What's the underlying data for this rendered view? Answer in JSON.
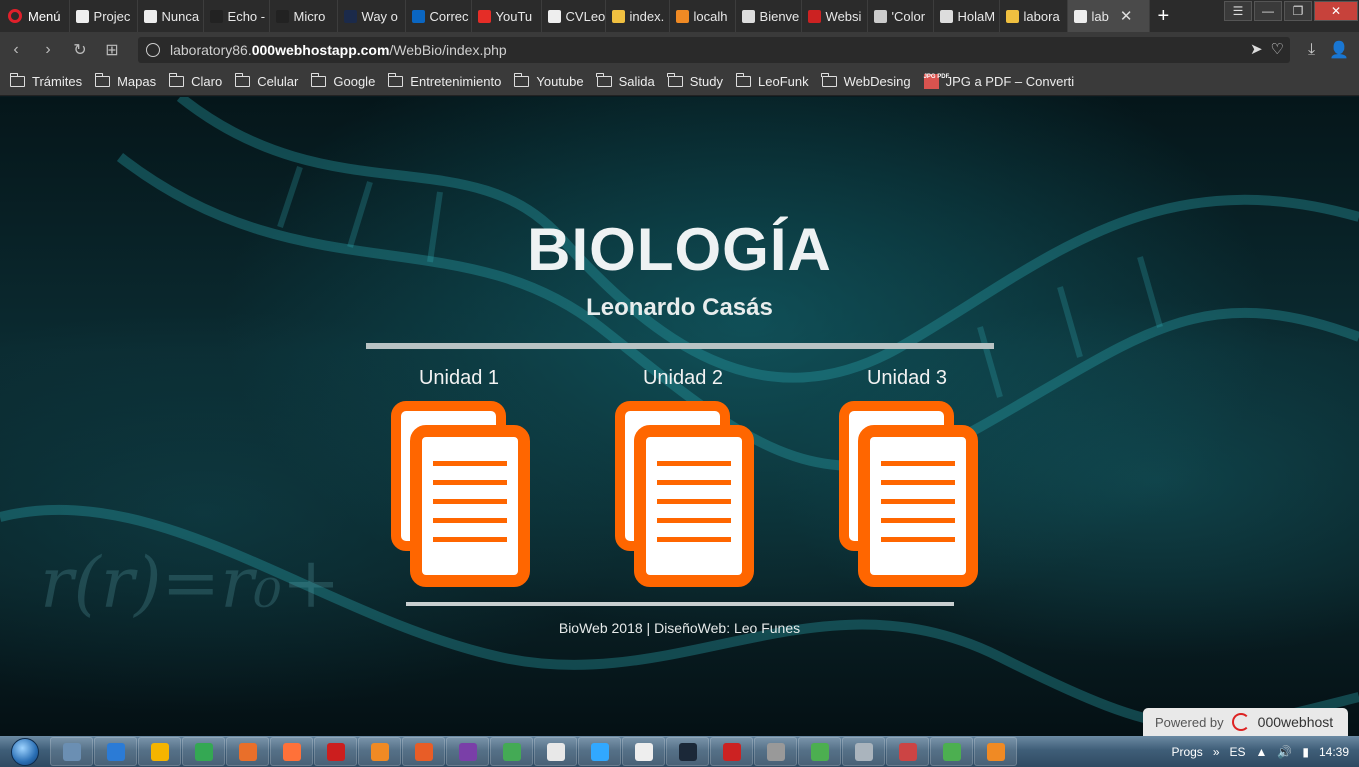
{
  "browser": {
    "menu_label": "Menú",
    "tabs": [
      {
        "label": "Projec",
        "color": "#eeeeee"
      },
      {
        "label": "Nunca",
        "color": "#eeeeee"
      },
      {
        "label": "Echo -",
        "color": "#222222"
      },
      {
        "label": "Micro",
        "color": "#222222"
      },
      {
        "label": "Way o",
        "color": "#1b2a4a"
      },
      {
        "label": "Correc",
        "color": "#0a66c2"
      },
      {
        "label": "YouTu",
        "color": "#e52d27"
      },
      {
        "label": "CVLeo",
        "color": "#eeeeee"
      },
      {
        "label": "index.",
        "color": "#f0c040"
      },
      {
        "label": "localh",
        "color": "#f08a24"
      },
      {
        "label": "Bienve",
        "color": "#dddddd"
      },
      {
        "label": "Websi",
        "color": "#cc2222"
      },
      {
        "label": "'Color",
        "color": "#cccccc"
      },
      {
        "label": "HolaM",
        "color": "#dddddd"
      },
      {
        "label": "labora",
        "color": "#f0c040"
      },
      {
        "label": "lab",
        "color": "#eeeeee"
      }
    ],
    "url_prefix": "laboratory86.",
    "url_domain": "000webhostapp.com",
    "url_path": "/WebBio/index.php",
    "bookmarks": [
      "Trámites",
      "Mapas",
      "Claro",
      "Celular",
      "Google",
      "Entretenimiento",
      "Youtube",
      "Salida",
      "Study",
      "LeoFunk",
      "WebDesing"
    ],
    "bookmark_pdf": "JPG a PDF – Converti",
    "bookmark_pdf_icon": "JPG PDF"
  },
  "page": {
    "title": "BIOLOGÍA",
    "subtitle": "Leonardo Casás",
    "units": [
      "Unidad 1",
      "Unidad 2",
      "Unidad 3"
    ],
    "doc_color": "#ff6600",
    "footer": "BioWeb 2018 | DiseñoWeb: Leo Funes",
    "powered_by": "Powered by",
    "powered_brand": "000webhost"
  },
  "taskbar": {
    "apps": [
      "#6b8fb3",
      "#2b7bd6",
      "#f5b400",
      "#34a853",
      "#e96f2a",
      "#ff7139",
      "#cc1e1e",
      "#f08a24",
      "#e85d27",
      "#7a3fa8",
      "#44aa55",
      "#e8e8e8",
      "#31a8ff",
      "#eeeeee",
      "#1b2838",
      "#cc2222",
      "#999999",
      "#4caf50",
      "#aab4bd",
      "#cc4444",
      "#4caf50",
      "#f08a24"
    ],
    "progs_label": "Progs",
    "lang": "ES",
    "time": "14:39"
  }
}
